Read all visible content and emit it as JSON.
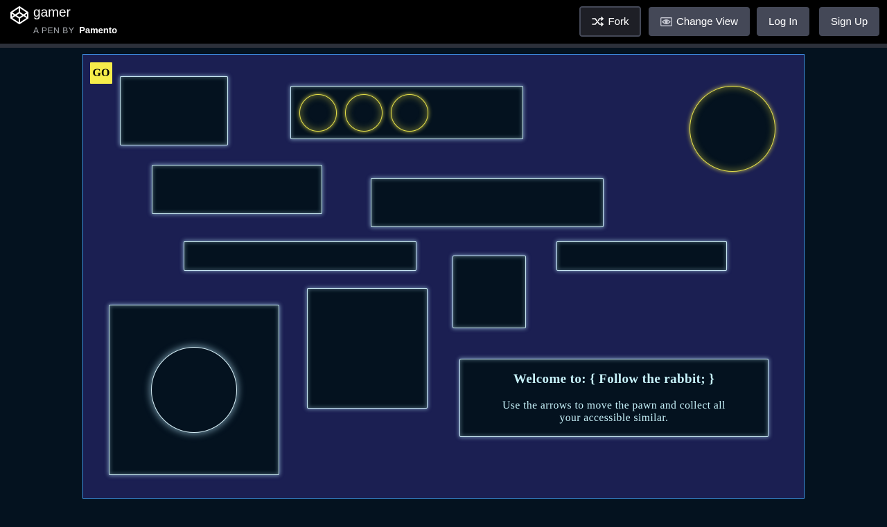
{
  "header": {
    "pen_title": "gamer",
    "pen_by": "A PEN BY",
    "author": "Pamento",
    "buttons": {
      "fork": "Fork",
      "change_view": "Change View",
      "log_in": "Log In",
      "sign_up": "Sign Up"
    },
    "icons": {
      "logo": "codepen-logo-icon",
      "fork": "fork-icon",
      "change_view": "eye-icon"
    }
  },
  "game": {
    "go_label": "GO",
    "welcome_title": "Welcome to: { Follow the rabbit; }",
    "welcome_body": "Use the arrows to move the pawn and collect all your accessible similar.",
    "colors": {
      "stage_background": "#1b1f52",
      "wall": "#04121f",
      "glow": "#c7e6f2",
      "coin": "#e6e04a",
      "go_button": "#f6ed4a",
      "stage_border": "#3d8ee0"
    }
  }
}
